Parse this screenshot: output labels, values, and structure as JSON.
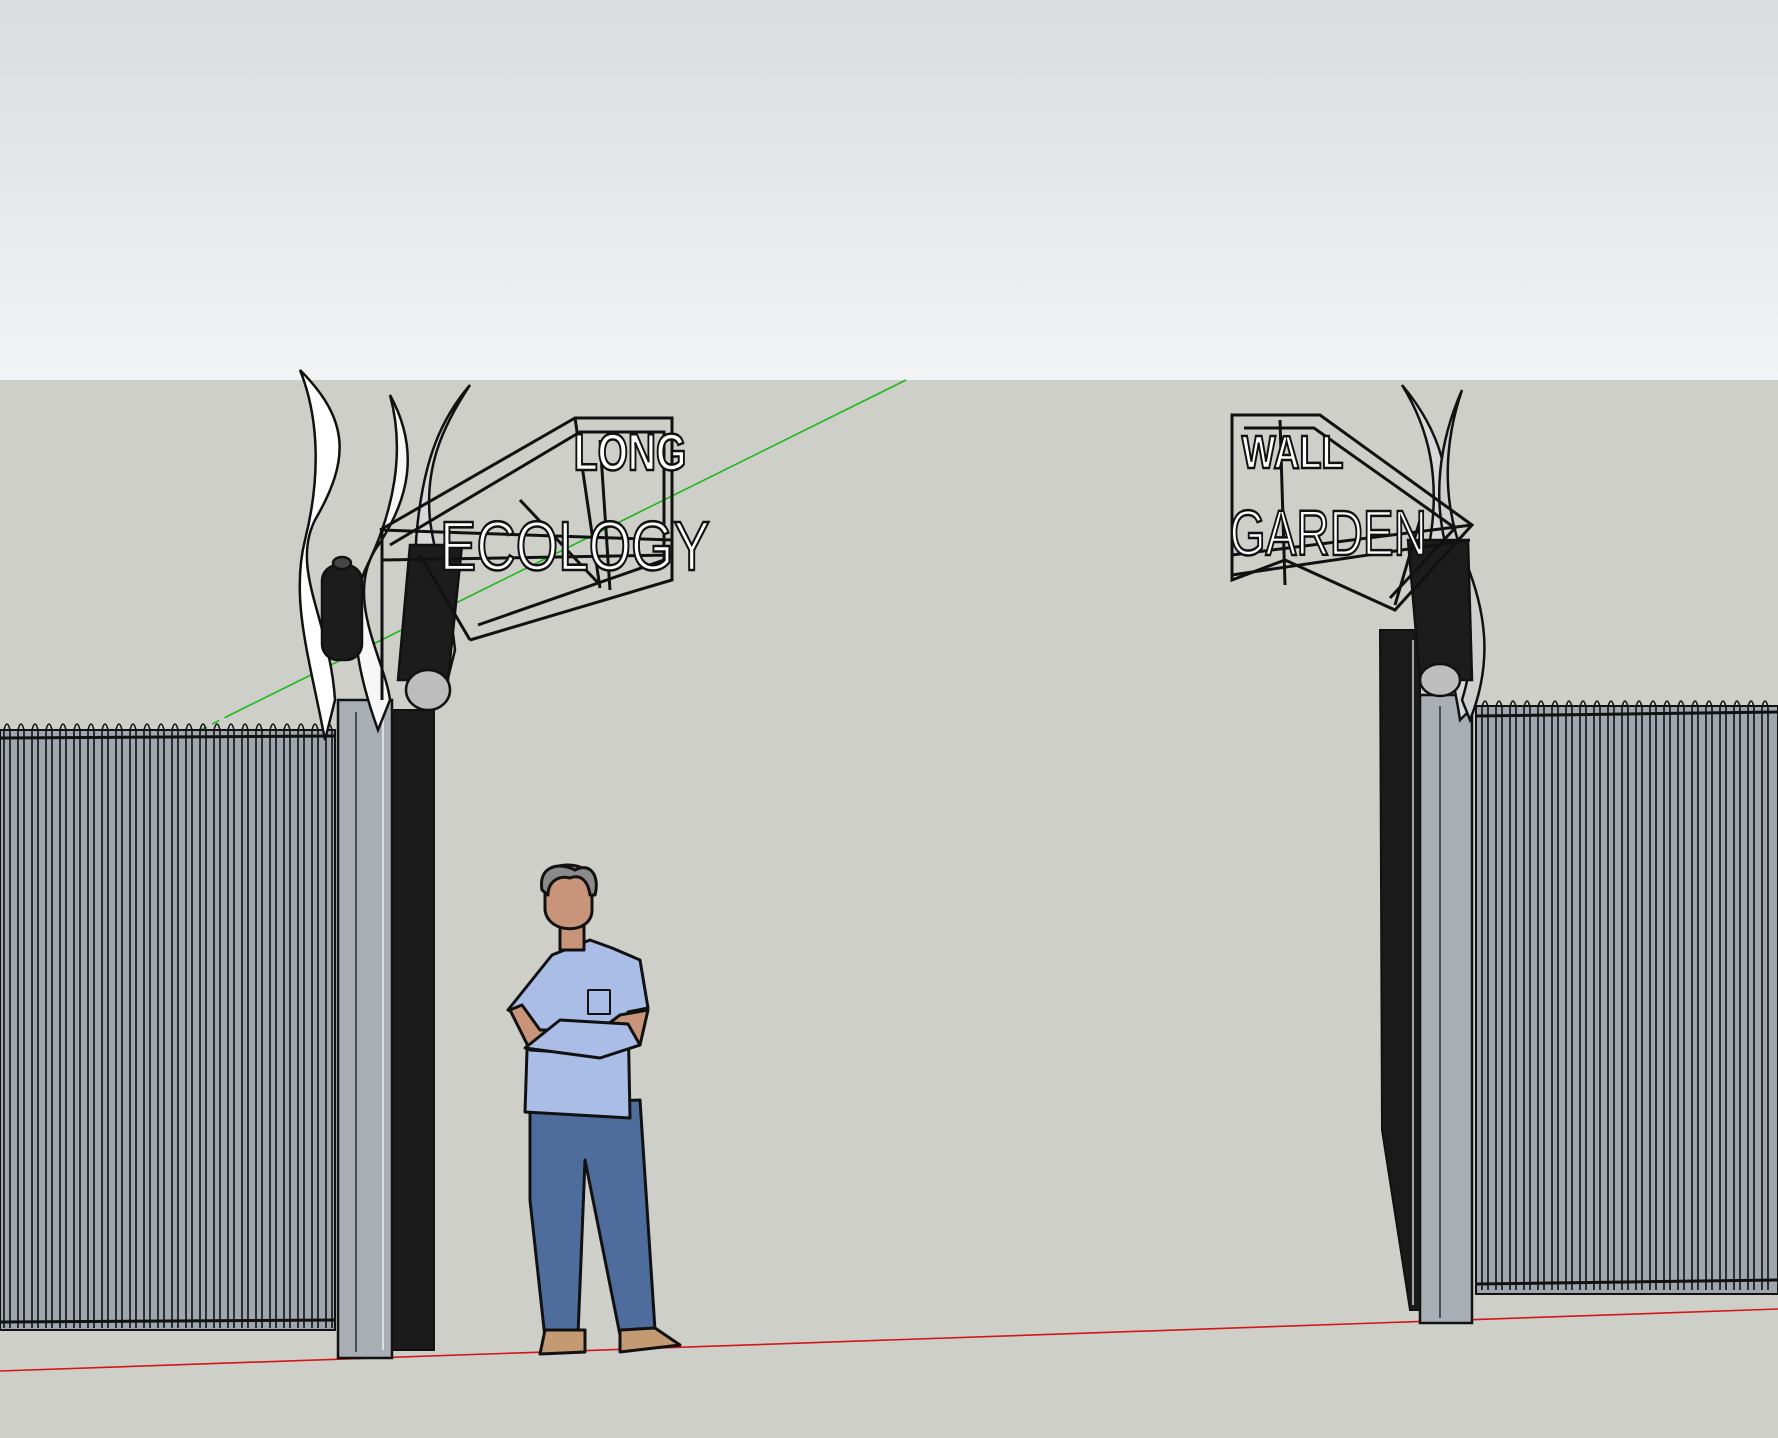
{
  "colors": {
    "sky_top": "#d9dde0",
    "sky_bottom": "#f2f3f4",
    "ground": "#cfcfca",
    "fence_fill": "#9fa6ad",
    "post_fill": "#a8aeb4",
    "ink": "#111111",
    "axis_red": "#d01818",
    "axis_green": "#1cb81c",
    "shirt": "#a9bde6",
    "jeans": "#4e6c9c",
    "skin": "#c8957a",
    "hair": "#8a8a8a",
    "shoes": "#c39a72"
  },
  "sign_left": {
    "top_word": "LONG",
    "bottom_word": "ECOLOGY"
  },
  "sign_right": {
    "top_word": "WALL",
    "bottom_word": "GARDEN"
  },
  "person": {
    "icon": "scale-figure-icon"
  }
}
